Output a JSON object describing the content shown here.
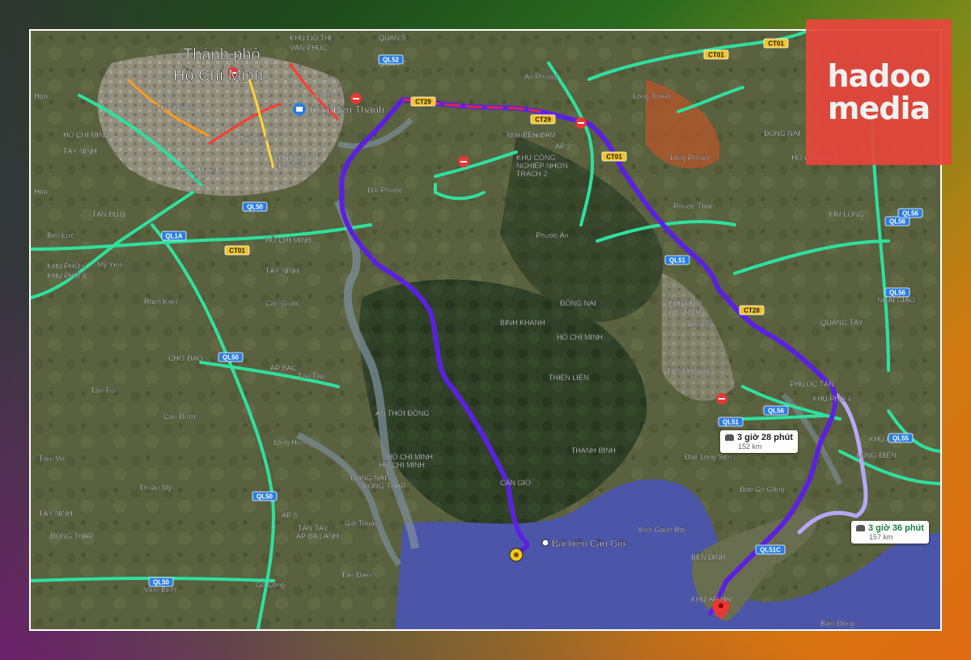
{
  "logo": {
    "line1": "hadoo",
    "line2": "media"
  },
  "map": {
    "city_title_1": "Thành phố",
    "city_title_2": "Hồ Chí Minh",
    "landmark": "Chợ Bến Thành",
    "destination_beach": "Bãi biển Cần Giờ",
    "places": [
      {
        "text": "KHU ĐÔ THỊ"
      },
      {
        "text": "VẠN PHÚC"
      },
      {
        "text": "QUẬN 9"
      },
      {
        "text": "Hóa"
      },
      {
        "text": "KHU PHỐ 22"
      },
      {
        "text": "QUẬN 2"
      },
      {
        "text": "QUẬN 7"
      },
      {
        "text": "CHỢ LỚN"
      },
      {
        "text": "KHU DÂN CƯ"
      },
      {
        "text": "KIM SƠN"
      },
      {
        "text": "KOC HƯƠNG"
      },
      {
        "text": "LÔ 5"
      },
      {
        "text": "HỒ CHÍ MINH"
      },
      {
        "text": "TÂY NINH"
      },
      {
        "text": "Hòa"
      },
      {
        "text": "TÂN BỬU"
      },
      {
        "text": "Bến Lức"
      },
      {
        "text": "KHU PHỐ 6"
      },
      {
        "text": "KHU PHỐ 8"
      },
      {
        "text": "Mỹ Yên"
      },
      {
        "text": "HỒ CHÍ MINH"
      },
      {
        "text": "TÂY NINH"
      },
      {
        "text": "Rạch Kiến"
      },
      {
        "text": "Cần Giuộc"
      },
      {
        "text": "CHỢ ĐÀO"
      },
      {
        "text": "ẤP BẮC"
      },
      {
        "text": "Tân Tập"
      },
      {
        "text": "Tân Trụ"
      },
      {
        "text": "Cần Đước"
      },
      {
        "text": "Long Hựu"
      },
      {
        "text": "Tầm Vu"
      },
      {
        "text": "Thuận Mỹ"
      },
      {
        "text": "TÂY NINH"
      },
      {
        "text": "ĐỒNG THÁP"
      },
      {
        "text": "ẤP 6"
      },
      {
        "text": "TÂN TẦY"
      },
      {
        "text": "ẤP BÀ LÁNH"
      },
      {
        "text": "Gia Thuận"
      },
      {
        "text": "Gò Công"
      },
      {
        "text": "Tân Điền"
      },
      {
        "text": "Vĩnh Bình"
      },
      {
        "text": "HỒ CHÍ MINH"
      },
      {
        "text": "ĐỒNG NAI"
      },
      {
        "text": "Đại Phước"
      },
      {
        "text": "Nhơn Trạch"
      },
      {
        "text": "KHU CÔNG"
      },
      {
        "text": "NGHIỆP NHƠN"
      },
      {
        "text": "TRẠCH 2"
      },
      {
        "text": "BẾN CAM"
      },
      {
        "text": "ẤP 2"
      },
      {
        "text": "Phước An"
      },
      {
        "text": "An Phước"
      },
      {
        "text": "Long Thành"
      },
      {
        "text": "Long Phước"
      },
      {
        "text": "Phước Thái"
      },
      {
        "text": "ĐỒNG NAI"
      },
      {
        "text": "HỒ CHÍ MINH"
      },
      {
        "text": "ĐỒNG NAI"
      },
      {
        "text": "HỒ CHÍ MINH"
      },
      {
        "text": "KIM LONG"
      },
      {
        "text": "BÌNH KHÁNH"
      },
      {
        "text": "THIỀN LIÊN"
      },
      {
        "text": "AN THỚI ĐÔNG"
      },
      {
        "text": "THẠNH BÌNH"
      },
      {
        "text": "CẦN GIỜ"
      },
      {
        "text": "HỒ CHÍ MINH"
      },
      {
        "text": "ĐỒNG THÁP"
      },
      {
        "text": "KHU PHỐ"
      },
      {
        "text": "TÂN PHÚ"
      },
      {
        "text": "Phú Mỹ"
      },
      {
        "text": "TÂN PHƯỚC"
      },
      {
        "text": "QUẢNG TÂY"
      },
      {
        "text": "NGÃI GIAO"
      },
      {
        "text": "PHƯỚC TÂN"
      },
      {
        "text": "KHU PHỐ 4"
      },
      {
        "text": "Đảo Long Sơn"
      },
      {
        "text": "Đảo Gò Găng"
      },
      {
        "text": "LONG ĐIỀN"
      },
      {
        "text": "KHU PHỐ"
      },
      {
        "text": "BẾN ĐÌNH"
      },
      {
        "text": "KHU ẤP HẢI"
      },
      {
        "text": "Vịnh Gành Rái"
      },
      {
        "text": "Biển Đông"
      }
    ],
    "road_shields": [
      {
        "text": "QL52"
      },
      {
        "text": "CT29"
      },
      {
        "text": "CT29"
      },
      {
        "text": "CT01"
      },
      {
        "text": "CT01"
      },
      {
        "text": "QL50"
      },
      {
        "text": "QL1A"
      },
      {
        "text": "CT01"
      },
      {
        "text": "QL50"
      },
      {
        "text": "QL50"
      },
      {
        "text": "QL50"
      },
      {
        "text": "QL51"
      },
      {
        "text": "CT28"
      },
      {
        "text": "QL56"
      },
      {
        "text": "QL56"
      },
      {
        "text": "QL51"
      },
      {
        "text": "QL56"
      },
      {
        "text": "QL55"
      },
      {
        "text": "QL51C"
      },
      {
        "text": "CT01"
      },
      {
        "text": "QL56"
      }
    ]
  },
  "routes": [
    {
      "time": "3 giờ 28 phút",
      "distance": "152 km",
      "selected": true,
      "color": "#5b21e0"
    },
    {
      "time": "3 giờ 36 phút",
      "distance": "157 km",
      "selected": false,
      "color": "#b7a7f7"
    }
  ],
  "colors": {
    "route": "#5b21e0",
    "route_alt": "#b7a7f7",
    "highway": "#2fe0a0",
    "water": "#4b56a8",
    "logo_bg": "#e8453c"
  }
}
